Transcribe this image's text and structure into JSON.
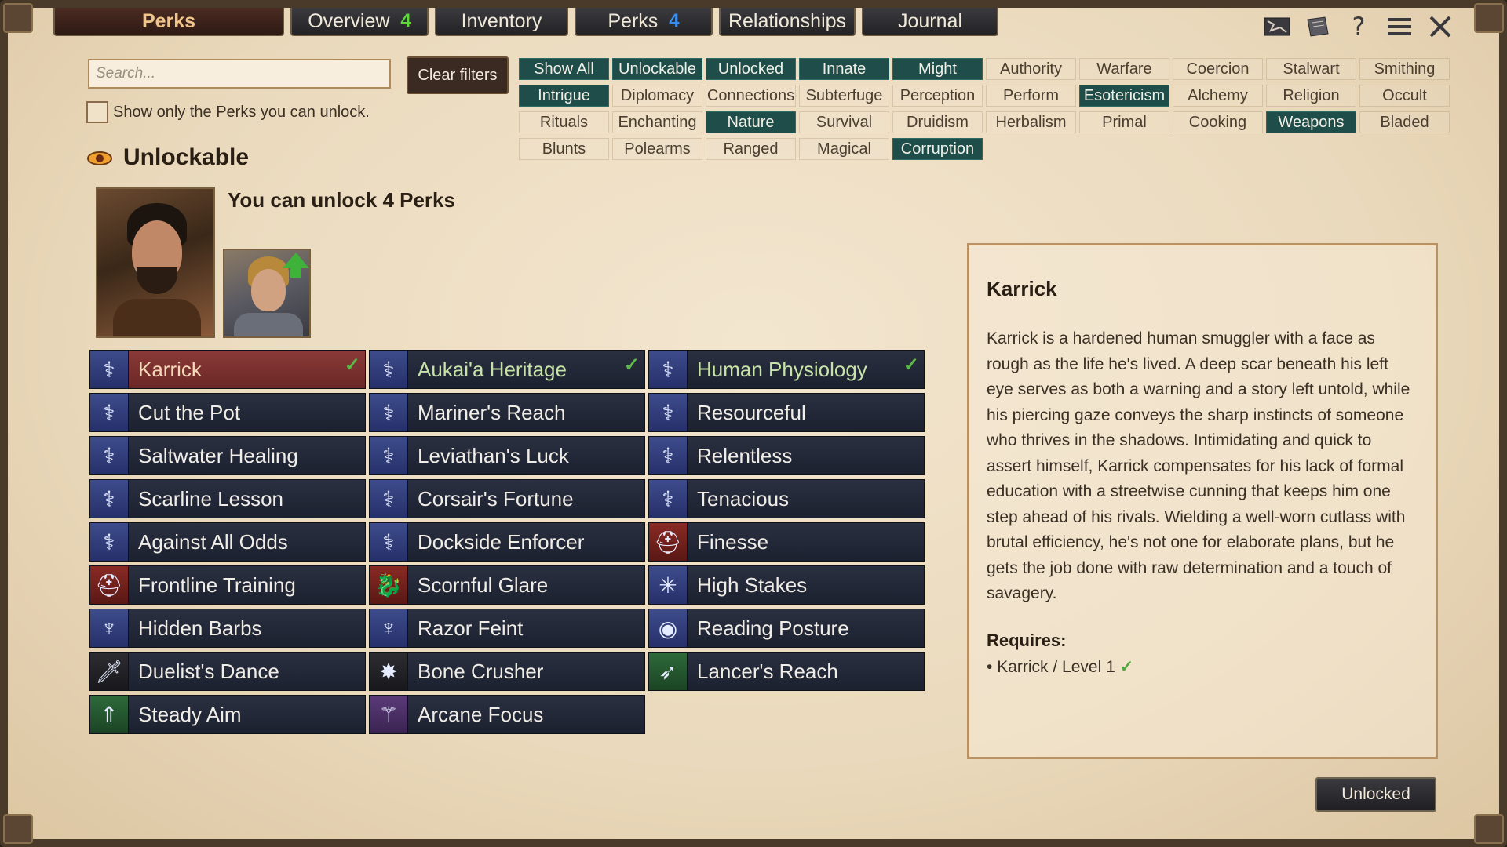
{
  "tabs": [
    {
      "label": "Perks",
      "badge": ""
    },
    {
      "label": "Overview",
      "badge": "4",
      "badge_color": "#5fd83a"
    },
    {
      "label": "Inventory",
      "badge": ""
    },
    {
      "label": "Perks",
      "badge": "4",
      "badge_color": "#3b8ef0"
    },
    {
      "label": "Relationships",
      "badge": ""
    },
    {
      "label": "Journal",
      "badge": ""
    }
  ],
  "top_icons": [
    "map-icon",
    "scroll-icon",
    "help-icon",
    "menu-icon",
    "close-icon"
  ],
  "search": {
    "placeholder": "Search...",
    "value": ""
  },
  "clear_filters": "Clear filters",
  "only_unlockable_label": "Show only the Perks you can unlock.",
  "filters": [
    {
      "label": "Show All",
      "on": true
    },
    {
      "label": "Unlockable",
      "on": true
    },
    {
      "label": "Unlocked",
      "on": true
    },
    {
      "label": "Innate",
      "on": true
    },
    {
      "label": "Might",
      "on": true
    },
    {
      "label": "Authority",
      "on": false
    },
    {
      "label": "Warfare",
      "on": false
    },
    {
      "label": "Coercion",
      "on": false
    },
    {
      "label": "Stalwart",
      "on": false
    },
    {
      "label": "Smithing",
      "on": false
    },
    {
      "label": "Intrigue",
      "on": true
    },
    {
      "label": "Diplomacy",
      "on": false
    },
    {
      "label": "Connections",
      "on": false
    },
    {
      "label": "Subterfuge",
      "on": false
    },
    {
      "label": "Perception",
      "on": false
    },
    {
      "label": "Perform",
      "on": false
    },
    {
      "label": "Esotericism",
      "on": true
    },
    {
      "label": "Alchemy",
      "on": false
    },
    {
      "label": "Religion",
      "on": false
    },
    {
      "label": "Occult",
      "on": false
    },
    {
      "label": "Rituals",
      "on": false
    },
    {
      "label": "Enchanting",
      "on": false
    },
    {
      "label": "Nature",
      "on": true
    },
    {
      "label": "Survival",
      "on": false
    },
    {
      "label": "Druidism",
      "on": false
    },
    {
      "label": "Herbalism",
      "on": false
    },
    {
      "label": "Primal",
      "on": false
    },
    {
      "label": "Cooking",
      "on": false
    },
    {
      "label": "Weapons",
      "on": true
    },
    {
      "label": "Bladed",
      "on": false
    },
    {
      "label": "Blunts",
      "on": false
    },
    {
      "label": "Polearms",
      "on": false
    },
    {
      "label": "Ranged",
      "on": false
    },
    {
      "label": "Magical",
      "on": false
    },
    {
      "label": "Corruption",
      "on": true
    }
  ],
  "unlockable": {
    "title": "Unlockable",
    "summary": "You can unlock 4 Perks"
  },
  "perks": [
    {
      "name": "Karrick",
      "icon": "dna-icon",
      "tone": "blue",
      "unlocked": true,
      "selected": true
    },
    {
      "name": "Aukai'a Heritage",
      "icon": "dna-icon",
      "tone": "blue",
      "unlocked": true
    },
    {
      "name": "Human Physiology",
      "icon": "dna-icon",
      "tone": "blue",
      "unlocked": true
    },
    {
      "name": "Cut the Pot",
      "icon": "dna-icon",
      "tone": "blue"
    },
    {
      "name": "Mariner's Reach",
      "icon": "dna-icon",
      "tone": "blue"
    },
    {
      "name": "Resourceful",
      "icon": "dna-icon",
      "tone": "blue"
    },
    {
      "name": "Saltwater Healing",
      "icon": "dna-icon",
      "tone": "blue"
    },
    {
      "name": "Leviathan's Luck",
      "icon": "dna-icon",
      "tone": "blue"
    },
    {
      "name": "Relentless",
      "icon": "dna-icon",
      "tone": "blue"
    },
    {
      "name": "Scarline Lesson",
      "icon": "dna-icon",
      "tone": "blue"
    },
    {
      "name": "Corsair's Fortune",
      "icon": "dna-icon",
      "tone": "blue"
    },
    {
      "name": "Tenacious",
      "icon": "dna-icon",
      "tone": "blue"
    },
    {
      "name": "Against All Odds",
      "icon": "dna-icon",
      "tone": "blue"
    },
    {
      "name": "Dockside Enforcer",
      "icon": "dna-icon",
      "tone": "blue"
    },
    {
      "name": "Finesse",
      "icon": "helmet-icon",
      "tone": "red"
    },
    {
      "name": "Frontline Training",
      "icon": "helmet-icon",
      "tone": "red"
    },
    {
      "name": "Scornful Glare",
      "icon": "dragon-icon",
      "tone": "red"
    },
    {
      "name": "High Stakes",
      "icon": "web-icon",
      "tone": "blue"
    },
    {
      "name": "Hidden Barbs",
      "icon": "kraken-icon",
      "tone": "blue"
    },
    {
      "name": "Razor Feint",
      "icon": "kraken-icon",
      "tone": "blue"
    },
    {
      "name": "Reading Posture",
      "icon": "eye-icon",
      "tone": "blue"
    },
    {
      "name": "Duelist's Dance",
      "icon": "sword-icon",
      "tone": "dark"
    },
    {
      "name": "Bone Crusher",
      "icon": "mace-icon",
      "tone": "dark"
    },
    {
      "name": "Lancer's Reach",
      "icon": "spear-icon",
      "tone": "green"
    },
    {
      "name": "Steady Aim",
      "icon": "bow-icon",
      "tone": "green"
    },
    {
      "name": "Arcane Focus",
      "icon": "staff-icon",
      "tone": "purple"
    }
  ],
  "detail": {
    "title": "Karrick",
    "description": "Karrick is a hardened human smuggler with a face as rough as the life he's lived. A deep scar beneath his left eye serves as both a warning and a story left untold, while his piercing gaze conveys the sharp instincts of someone who thrives in the shadows. Intimidating and quick to assert himself, Karrick compensates for his lack of formal education with a streetwise cunning that keeps him one step ahead of his rivals. Wielding a well-worn cutlass with brutal efficiency, he's not one for elaborate plans, but he gets the job done with raw determination and a touch of savagery.",
    "requires_label": "Requires:",
    "requires": "Karrick / Level 1"
  },
  "action_button": "Unlocked",
  "colors": {
    "active_filter": "#1f4d4a",
    "selected_perk": "#8a3a38",
    "perk_bg": "#1c2130",
    "check": "#5fb84a"
  }
}
